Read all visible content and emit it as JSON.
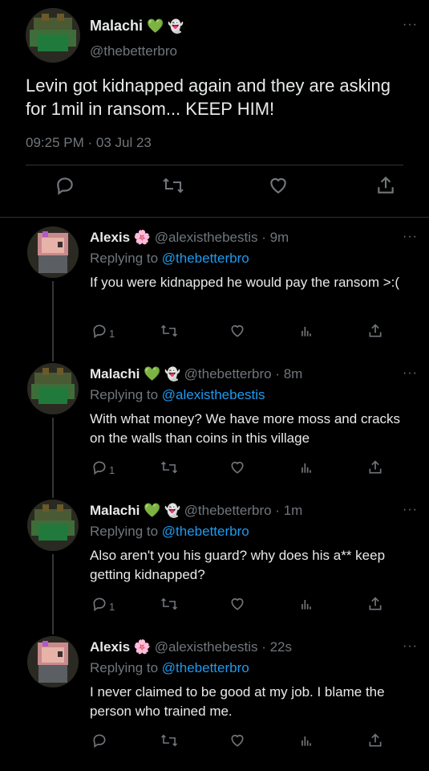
{
  "main": {
    "name": "Malachi",
    "handle": "@thebetterbro",
    "text": "Levin got kidnapped again and they are asking for 1mil in ransom... KEEP HIM!",
    "timestamp": "09:25 PM · 03 Jul 23",
    "more_icon": "···"
  },
  "replies": [
    {
      "name": "Alexis",
      "handle_time": "@alexisthebestis · 9m",
      "replying_prefix": "Replying to ",
      "replying_to": "@thebetterbro",
      "text": "If you were kidnapped he would pay the ransom >:(",
      "reply_count": "1"
    },
    {
      "name": "Malachi",
      "handle_time": "@thebetterbro · 8m",
      "replying_prefix": "Replying to ",
      "replying_to": "@alexisthebestis",
      "text": "With what money? We have more moss and cracks on the walls than coins in this village",
      "reply_count": "1"
    },
    {
      "name": "Malachi",
      "handle_time": "@thebetterbro · 1m",
      "replying_prefix": "Replying to ",
      "replying_to": "@thebetterbro",
      "text": "Also aren't you his guard? why does his a** keep getting kidnapped?",
      "reply_count": "1"
    },
    {
      "name": "Alexis",
      "handle_time": "@alexisthebestis · 22s",
      "replying_prefix": "Replying to ",
      "replying_to": "@thebetterbro",
      "text": "I never claimed to be good at my job. I blame the person who trained me.",
      "reply_count": ""
    }
  ],
  "colors": {
    "accent": "#1d9bf0",
    "muted": "#71767b",
    "green_heart": "#2ec24a",
    "pink_flower": "#e86ab0"
  }
}
